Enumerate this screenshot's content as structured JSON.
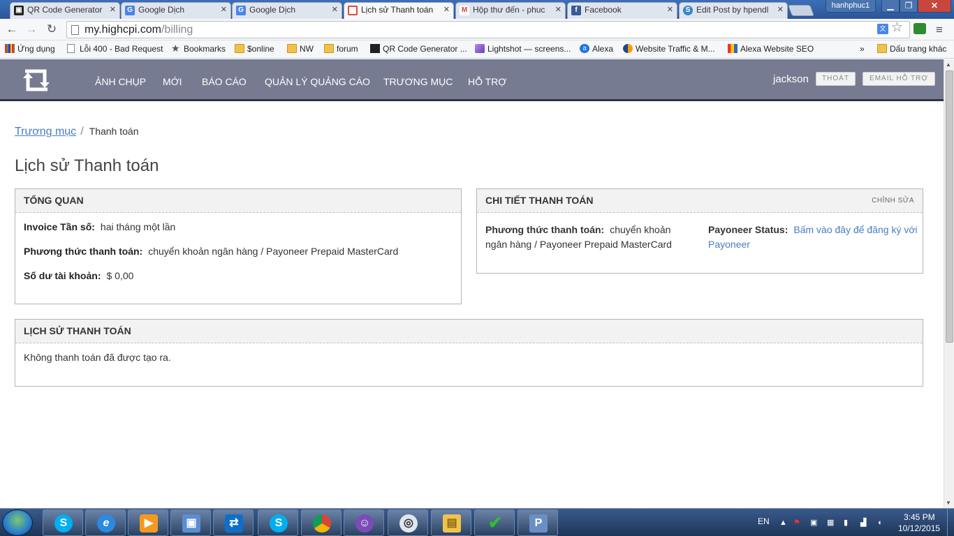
{
  "browser": {
    "tabs": [
      {
        "title": "QR Code Generator",
        "icon": "qr-icon"
      },
      {
        "title": "Google Dịch",
        "icon": "google-translate-icon"
      },
      {
        "title": "Google Dịch",
        "icon": "google-translate-icon"
      },
      {
        "title": "Lịch sử Thanh toán",
        "icon": "highcpi-icon"
      },
      {
        "title": "Hộp thư đến - phuc",
        "icon": "gmail-icon"
      },
      {
        "title": "Facebook",
        "icon": "facebook-icon"
      },
      {
        "title": "Edit Post by hpendl",
        "icon": "edit-post-icon"
      }
    ],
    "tab_close": "✕",
    "profile_name": "hanhphuc1",
    "url_host": "my.highcpi.com",
    "url_path": "/billing",
    "bookmarks": [
      {
        "label": "Ứng dụng",
        "icon": "apps-icon"
      },
      {
        "label": "Lỗi 400 - Bad Request",
        "icon": "page-icon"
      },
      {
        "label": "Bookmarks",
        "icon": "star-icon"
      },
      {
        "label": "$online",
        "icon": "folder-icon"
      },
      {
        "label": "NW",
        "icon": "folder-icon"
      },
      {
        "label": "forum",
        "icon": "folder-icon"
      },
      {
        "label": "QR Code Generator ...",
        "icon": "qr-icon"
      },
      {
        "label": "Lightshot — screens...",
        "icon": "lightshot-icon"
      },
      {
        "label": "Alexa",
        "icon": "alexa-icon"
      },
      {
        "label": "Website Traffic & M...",
        "icon": "traffic-icon"
      },
      {
        "label": "Alexa Website SEO",
        "icon": "chart-icon"
      }
    ],
    "bookmarks_more": "»",
    "other_bookmarks": "Dấu trang khác"
  },
  "site": {
    "nav": [
      "ẢNH CHỤP",
      "MỚI",
      "BÁO CÁO",
      "QUẢN LÝ QUẢNG CÁO",
      "TRƯƠNG MỤC",
      "HỖ TRỢ"
    ],
    "username": "jackson",
    "logout_label": "THOÁT",
    "support_email_label": "EMAIL HỖ TRỢ"
  },
  "breadcrumb": {
    "parent": "Trương mục",
    "separator": "/",
    "current": "Thanh toán"
  },
  "page_title": "Lịch sử Thanh toán",
  "overview": {
    "heading": "TỔNG QUAN",
    "rows": [
      {
        "label": "Invoice Tần số:",
        "value": "hai tháng một lần"
      },
      {
        "label": "Phương thức thanh toán:",
        "value": "chuyển khoản ngân hàng / Payoneer Prepaid MasterCard"
      },
      {
        "label": "Số dư tài khoản:",
        "value": "$ 0,00"
      }
    ]
  },
  "payment_details": {
    "heading": "CHI TIẾT THANH TOÁN",
    "edit_label": "CHỈNH SỬA",
    "method_label": "Phương thức thanh toán:",
    "method_value": "chuyển khoản ngân hàng / Payoneer Prepaid MasterCard",
    "payoneer_label": "Payoneer Status:",
    "payoneer_link": "Bấm vào đây để đăng ký với Payoneer"
  },
  "history": {
    "heading": "LỊCH SỬ THANH TOÁN",
    "empty_message": "Không thanh toán đã được tạo ra."
  },
  "taskbar": {
    "apps": [
      "skype-icon",
      "internet-explorer-icon",
      "media-player-icon",
      "network-icon",
      "teamviewer-icon",
      "skype-icon",
      "chrome-icon",
      "yahoo-messenger-icon",
      "weibo-icon",
      "file-explorer-icon",
      "checkmark-icon",
      "remote-desktop-icon"
    ],
    "language": "EN",
    "time": "3:45 PM",
    "date": "10/12/2015"
  },
  "colors": {
    "header_bg": "#767b91",
    "link": "#4a7cc2",
    "panel_head_bg": "#f2f2f2"
  }
}
